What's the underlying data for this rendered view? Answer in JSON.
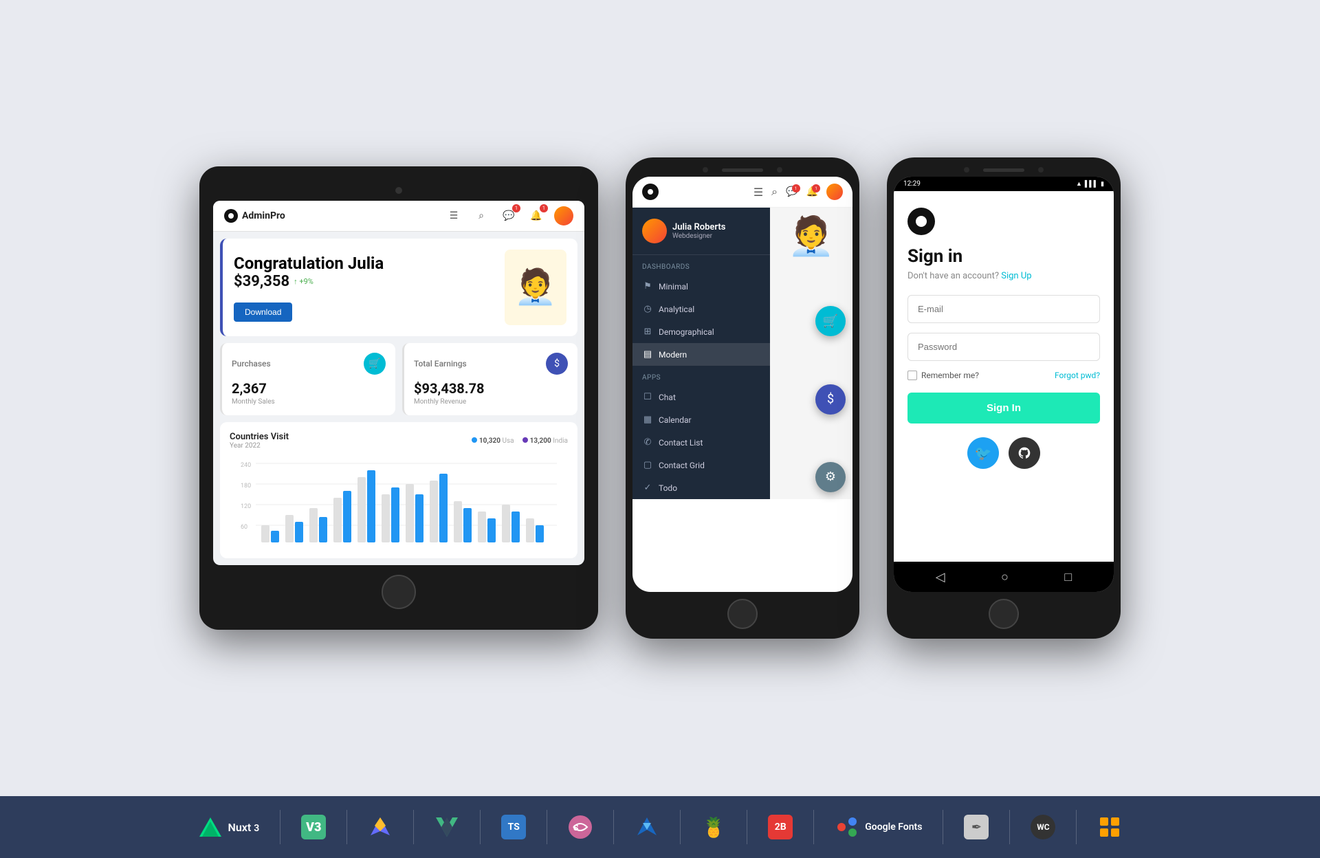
{
  "tablet": {
    "logo": "AdminPro",
    "welcome": {
      "greeting": "Congratulation Julia",
      "amount": "$39,358",
      "growth": "↑ +9%",
      "download_label": "Download"
    },
    "purchases": {
      "title": "Purchases",
      "value": "2,367",
      "sub": "Monthly Sales"
    },
    "earnings": {
      "title": "Total Earnings",
      "value": "$93,438.78",
      "sub": "Monthly Revenue"
    },
    "chart": {
      "title": "Countries Visit",
      "sub": "Year 2022",
      "legend1_label": "10,320",
      "legend1_sub": "Usa",
      "legend2_label": "13,200",
      "legend2_sub": "India",
      "y_labels": [
        "240",
        "180",
        "120",
        "60"
      ]
    }
  },
  "phone_menu": {
    "user": {
      "name": "Julia Roberts",
      "role": "Webdesigner"
    },
    "sections": {
      "dashboards_label": "Dashboards",
      "apps_label": "Apps"
    },
    "menu_items": [
      {
        "label": "Minimal",
        "icon": "⚑",
        "active": false
      },
      {
        "label": "Analytical",
        "icon": "◷",
        "active": false
      },
      {
        "label": "Demographical",
        "icon": "⊞",
        "active": false
      },
      {
        "label": "Modern",
        "icon": "▤",
        "active": true
      },
      {
        "label": "Chat",
        "icon": "☐",
        "active": false
      },
      {
        "label": "Calendar",
        "icon": "▦",
        "active": false
      },
      {
        "label": "Contact List",
        "icon": "✆",
        "active": false
      },
      {
        "label": "Contact Grid",
        "icon": "▢",
        "active": false
      },
      {
        "label": "Todo",
        "icon": "✓",
        "active": false
      }
    ]
  },
  "phone_signin": {
    "status_time": "12:29",
    "title": "Sign in",
    "subtitle": "Don't have an account?",
    "signup_label": "Sign Up",
    "email_placeholder": "E-mail",
    "password_placeholder": "Password",
    "remember_label": "Remember me?",
    "forgot_label": "Forgot pwd?",
    "signin_btn": "Sign In"
  },
  "footer": {
    "technologies": [
      {
        "name": "Nuxt",
        "version": "3",
        "color": "#00dc82",
        "shape": "triangle"
      },
      {
        "name": "V",
        "version": "3",
        "color": "#41b883",
        "shape": "V"
      },
      {
        "name": "Vite",
        "version": "",
        "color": "#646cff",
        "shape": "bolt"
      },
      {
        "name": "Vue",
        "version": "",
        "color": "#42b883",
        "shape": "vue"
      },
      {
        "name": "TS",
        "version": "",
        "color": "#3178c6",
        "shape": "ts"
      },
      {
        "name": "Sass",
        "version": "",
        "color": "#cc6699",
        "shape": "sass"
      },
      {
        "name": "Vuetify",
        "version": "",
        "color": "#1867c0",
        "shape": "vuetify"
      },
      {
        "name": "Pinia",
        "version": "",
        "color": "#ffd859",
        "shape": "pinia"
      },
      {
        "name": "2B",
        "version": "",
        "color": "#e53935",
        "shape": "2b"
      },
      {
        "name": "Google Fonts",
        "version": "",
        "color": "#4285f4",
        "shape": "gf"
      },
      {
        "name": "Quill",
        "version": "",
        "color": "#aaa",
        "shape": "quill"
      },
      {
        "name": "WC",
        "version": "",
        "color": "#333",
        "shape": "wc"
      },
      {
        "name": "Grid",
        "version": "",
        "color": "#ffa000",
        "shape": "grid"
      }
    ]
  }
}
